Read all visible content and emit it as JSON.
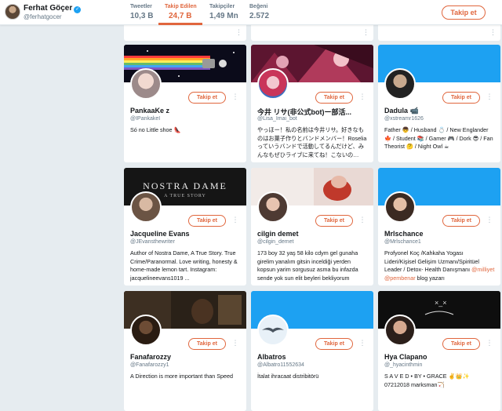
{
  "profile": {
    "name": "Ferhat Göçer",
    "handle": "@ferhatgocer",
    "follow_label": "Takip et"
  },
  "stats": [
    {
      "label": "Tweetler",
      "value": "10,3 B"
    },
    {
      "label": "Takip Edilen",
      "value": "24,7 B"
    },
    {
      "label": "Takipçiler",
      "value": "1,49 Mn"
    },
    {
      "label": "Beğeni",
      "value": "2.572"
    }
  ],
  "colors": {
    "accent": "#e0663d",
    "twitter_blue": "#1da1f2",
    "background": "#e6ecf0"
  },
  "cards": [
    {
      "name": "PankaaKe z",
      "handle": "@IPankakeI",
      "follow": "Takip et",
      "bio": "Só no Little shoe 👠"
    },
    {
      "name": "今井 リサ(非公式bot)ー部活...",
      "handle": "@Lisa_Imai_bot",
      "follow": "Takip et",
      "bio": "やっほー！私の名前は今井リサ。好きなものはお菓子作りとバンドメンバー！Roseliaっていうバンドで活動してるんだけど、みんなもぜひライブに来てね！こないの…"
    },
    {
      "name": "Dadula 📹",
      "handle": "@xstreamr1626",
      "follow": "Takip et",
      "bio": "Father 👦 / Husband 💍 / New Englander 🍁 / Student 📚 / Gamer 🎮 / Dork 😎 / Fan Theorist 🤔 / Night Owl ☕"
    },
    {
      "name": "Jacqueline Evans",
      "handle": "@JEvansthewriter",
      "follow": "Takip et",
      "bio": "Author of Nostra Dame, A True Story. True Crime/Paranormal. Love writing, honesty & home-made lemon tart. Instagram: jacquelineevans1019 ..."
    },
    {
      "name": "cilgin demet",
      "handle": "@cilgin_demet",
      "follow": "Takip et",
      "bio": "173 boy 32 yaş 58 kilo cdym gel gunaha girelim yanalım gitsin inceldiği yerden kopsun yarim sorgusuz asma bu infazda sende yok sun elit beyleri bekliyorum"
    },
    {
      "name": "Mrlschance",
      "handle": "@Mrlschance1",
      "follow": "Takip et",
      "bio_pre": "Profyonel Koç /Kahkaha Yogası Lideri/Kişisel Gelişim Uzmanı/Spiritüel Leader / Detox- Health Danışmanı ",
      "bio_link1": "@milliyet",
      "bio_mid": " ",
      "bio_link2": "@pembenar",
      "bio_post": " blog yazarı"
    },
    {
      "name": "Fanafarozzy",
      "handle": "@Fanafarozzy1",
      "follow": "Takip et",
      "bio": "A Direction is more important than Speed"
    },
    {
      "name": "Albatros",
      "handle": "@Albatro11552634",
      "follow": "Takip et",
      "bio": "İtalat ihracaat distribitörü"
    },
    {
      "name": "Hya Clapano",
      "handle": "@_hyacinthmin",
      "follow": "Takip et",
      "bio": "S A V E D • BY • GRACE ✌️👑✨ 07212018 marksman🏹"
    }
  ],
  "banner_texts": {
    "title": "NOSTRA DAME",
    "subtitle": "A TRUE STORY"
  },
  "menu_glyph": "⋮"
}
